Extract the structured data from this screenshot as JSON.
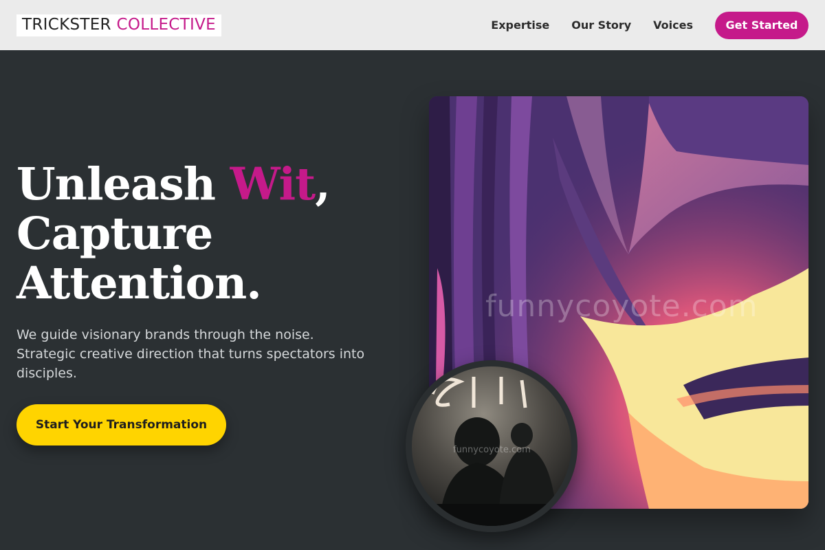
{
  "brand": {
    "name_part1": "TRICKSTER",
    "name_part2": "COLLECTIVE"
  },
  "nav": {
    "items": [
      "Expertise",
      "Our Story",
      "Voices"
    ],
    "cta": "Get Started"
  },
  "hero": {
    "title_word1": "Unleash",
    "title_accent": "Wit",
    "title_comma": ",",
    "title_line2": "Capture",
    "title_line3": "Attention.",
    "subtitle": "We guide visionary brands through the noise. Strategic creative direction that turns spectators into disciples.",
    "button": "Start Your Transformation"
  },
  "media": {
    "main_watermark": "funnycoyote.com",
    "small_watermark": "funnycoyote.com"
  },
  "colors": {
    "accent": "#c51a8a",
    "button_yellow": "#ffd400",
    "background": "#2b3033",
    "header": "#ebebeb"
  }
}
